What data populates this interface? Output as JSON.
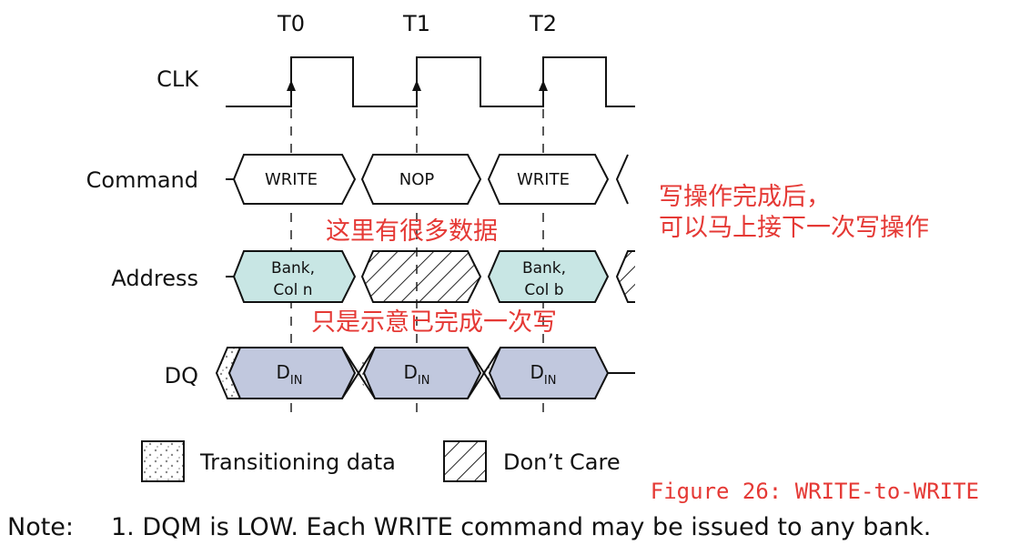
{
  "clock": {
    "ticks": [
      "T0",
      "T1",
      "T2"
    ]
  },
  "signals": {
    "clk": "CLK",
    "command": "Command",
    "address": "Address",
    "dq": "DQ"
  },
  "commands": [
    "WRITE",
    "NOP",
    "WRITE"
  ],
  "address": {
    "cell1_line1": "Bank,",
    "cell1_line2": "Col n",
    "cell3_line1": "Bank,",
    "cell3_line2": "Col b"
  },
  "dq": {
    "main": "D",
    "sub": "IN"
  },
  "annotations": {
    "right_line1": "写操作完成后，",
    "right_line2": "可以马上接下一次写操作",
    "middle_top": "这里有很多数据",
    "middle_bottom": "只是示意已完成一次写",
    "figure_caption": "Figure 26: WRITE-to-WRITE"
  },
  "legend": {
    "transitioning": "Transitioning data",
    "dont_care": "Don’t Care"
  },
  "note": {
    "prefix": "Note:",
    "text": "1.  DQM is LOW. Each WRITE command may be issued to any bank."
  },
  "colors": {
    "address_fill": "#c8e6e4",
    "dq_fill": "#c1c8de",
    "annotation": "#e53935"
  }
}
